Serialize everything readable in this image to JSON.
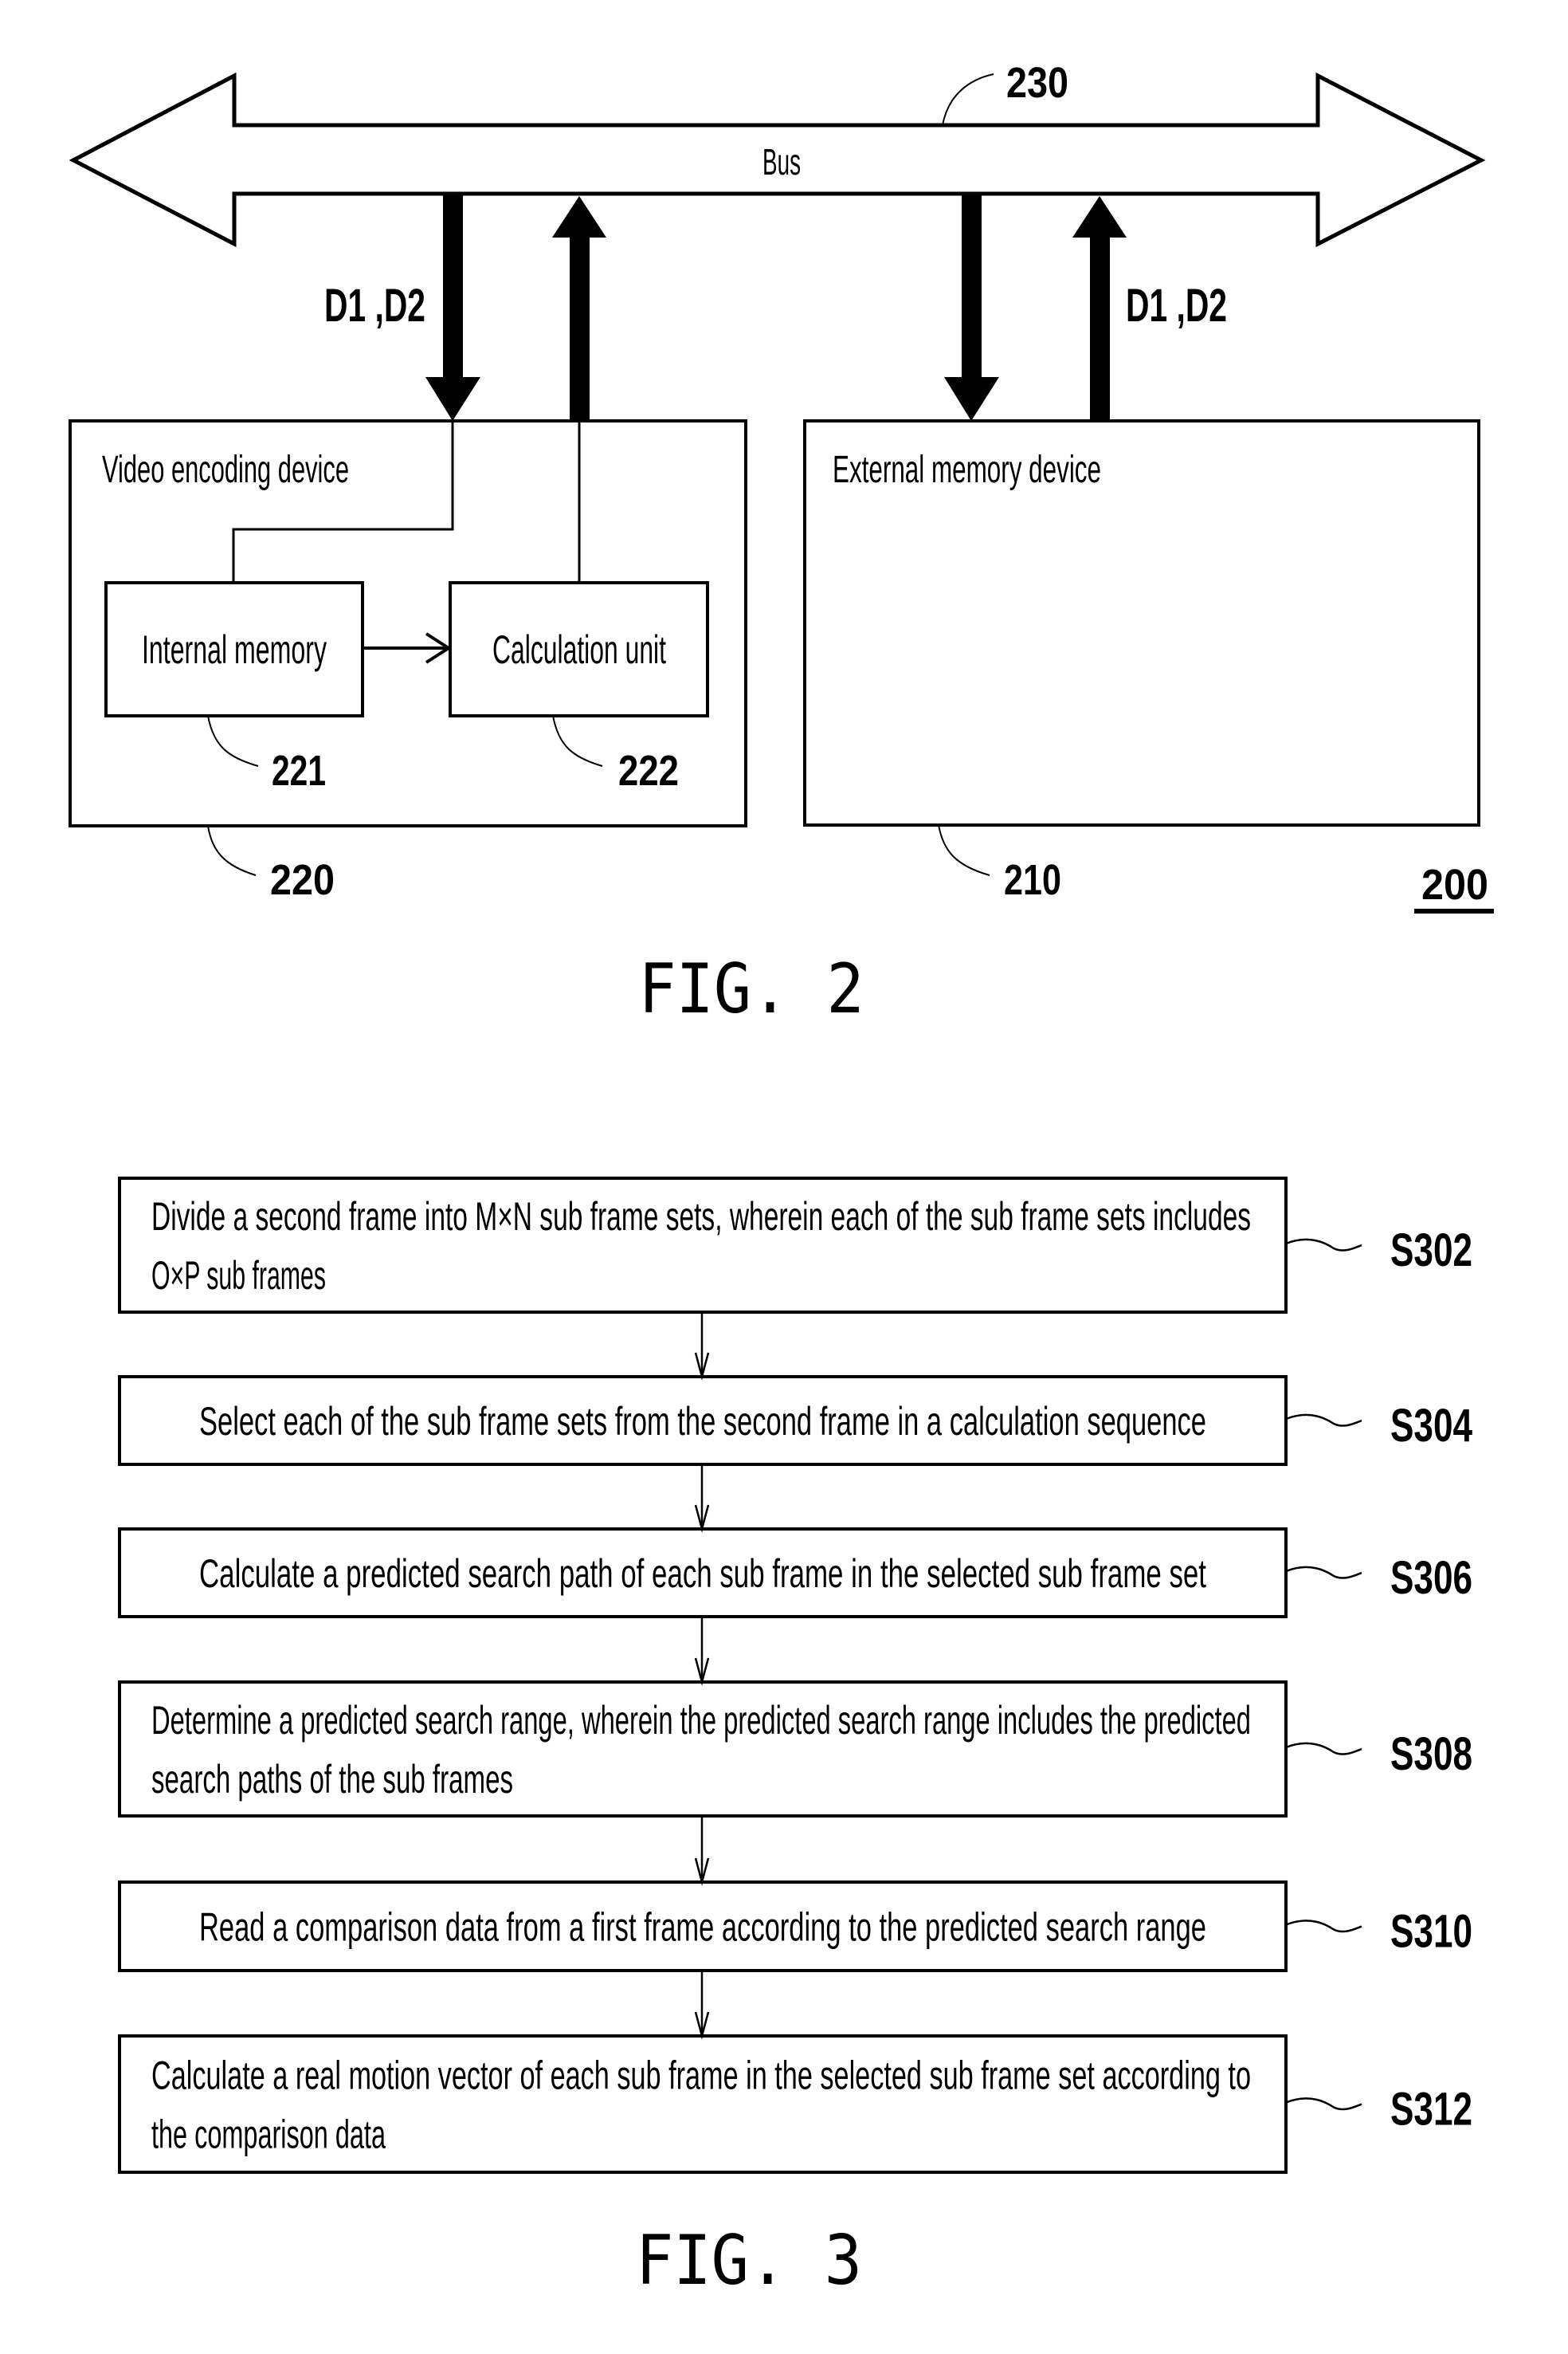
{
  "fig2": {
    "caption": "FIG. 2",
    "system_ref": "200",
    "bus": {
      "label": "Bus",
      "ref": "230"
    },
    "signal_label_left": "D1 ,D2",
    "signal_label_right": "D1 ,D2",
    "video_encoding_device": {
      "label": "Video encoding device",
      "ref": "220",
      "internal_memory": {
        "label": "Internal memory",
        "ref": "221"
      },
      "calculation_unit": {
        "label": "Calculation unit",
        "ref": "222"
      }
    },
    "external_memory_device": {
      "label": "External memory device",
      "ref": "210"
    }
  },
  "fig3": {
    "caption": "FIG. 3",
    "steps": [
      {
        "id": "S302",
        "lines": [
          "Divide a second frame into M×N sub frame sets, wherein each of the sub frame sets includes",
          "O×P sub frames"
        ],
        "align": "left"
      },
      {
        "id": "S304",
        "lines": [
          "Select each of the sub frame sets from the second frame in a calculation sequence"
        ],
        "align": "center"
      },
      {
        "id": "S306",
        "lines": [
          "Calculate a predicted search path of each sub frame in the selected sub frame set"
        ],
        "align": "center"
      },
      {
        "id": "S308",
        "lines": [
          "Determine a predicted search range, wherein the predicted search range includes the predicted",
          "search paths of the sub frames"
        ],
        "align": "left"
      },
      {
        "id": "S310",
        "lines": [
          "Read a comparison data from a first frame according to the predicted search range"
        ],
        "align": "center"
      },
      {
        "id": "S312",
        "lines": [
          "Calculate a real motion vector of each sub frame in the selected sub frame set according to",
          "the comparison data"
        ],
        "align": "left"
      }
    ]
  }
}
